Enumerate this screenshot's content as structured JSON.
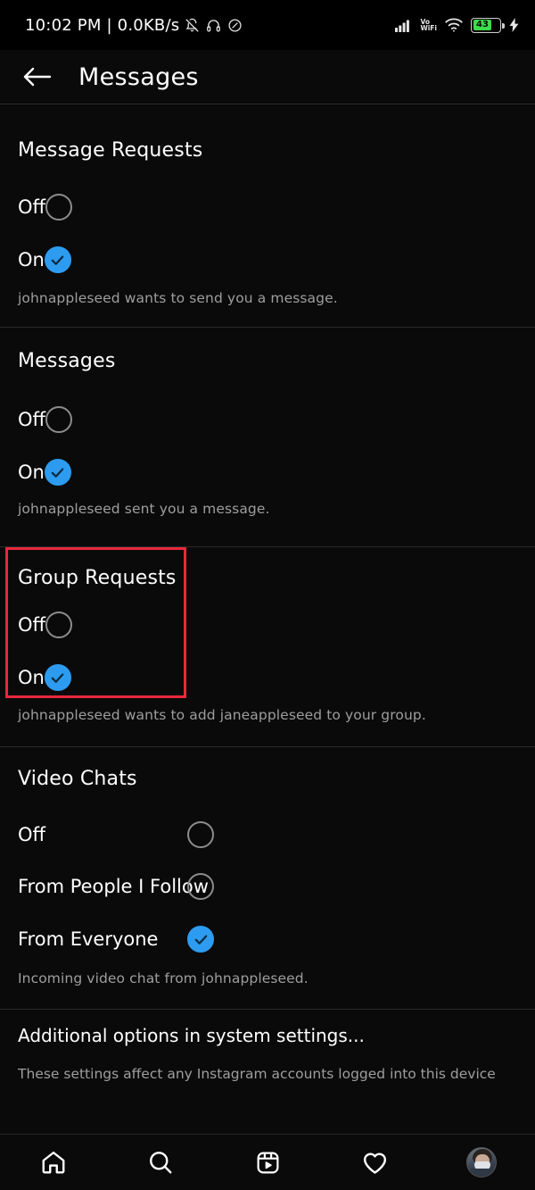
{
  "statusbar": {
    "clock": "10:02 PM | 0.0KB/s",
    "left_icons": [
      "bell-muted-icon",
      "headphones-icon",
      "dnd-icon"
    ],
    "right_icons": [
      "cellular-signal-icon",
      "volte-wifi-icon",
      "wifi-icon"
    ],
    "volte_line1": "Vo",
    "volte_line2": "WiFi",
    "battery_percent": "43",
    "battery_color": "#3ddc49",
    "charging": true
  },
  "header": {
    "back_icon": "arrow-left-icon",
    "title": "Messages"
  },
  "colors": {
    "accent_blue": "#2d9cf0",
    "highlight_red": "#e8283c",
    "background": "#0a0a0a",
    "divider": "#2a2a2a",
    "caption_gray": "#9e9e9e"
  },
  "sections": [
    {
      "id": "message-requests",
      "title": "Message Requests",
      "options": [
        {
          "label": "Off",
          "selected": false
        },
        {
          "label": "On",
          "selected": true
        }
      ],
      "caption": "johnappleseed wants to send you a message.",
      "highlighted": false
    },
    {
      "id": "messages",
      "title": "Messages",
      "options": [
        {
          "label": "Off",
          "selected": false
        },
        {
          "label": "On",
          "selected": true
        }
      ],
      "caption": "johnappleseed sent you a message.",
      "highlighted": false
    },
    {
      "id": "group-requests",
      "title": "Group Requests",
      "options": [
        {
          "label": "Off",
          "selected": false
        },
        {
          "label": "On",
          "selected": true
        }
      ],
      "caption": "johnappleseed wants to add janeappleseed to your group.",
      "highlighted": true
    },
    {
      "id": "video-chats",
      "title": "Video Chats",
      "options": [
        {
          "label": "Off",
          "selected": false
        },
        {
          "label": "From People I Follow",
          "selected": false
        },
        {
          "label": "From Everyone",
          "selected": true
        }
      ],
      "caption": "Incoming video chat from johnappleseed.",
      "highlighted": false
    }
  ],
  "additional": {
    "title": "Additional options in system settings...",
    "subtitle": "These settings affect any Instagram accounts logged into this device"
  },
  "navbar": {
    "items": [
      {
        "name": "home-icon",
        "label": "Home"
      },
      {
        "name": "search-icon",
        "label": "Search"
      },
      {
        "name": "reels-icon",
        "label": "Reels"
      },
      {
        "name": "heart-icon",
        "label": "Activity"
      },
      {
        "name": "profile-avatar",
        "label": "Profile"
      }
    ]
  }
}
